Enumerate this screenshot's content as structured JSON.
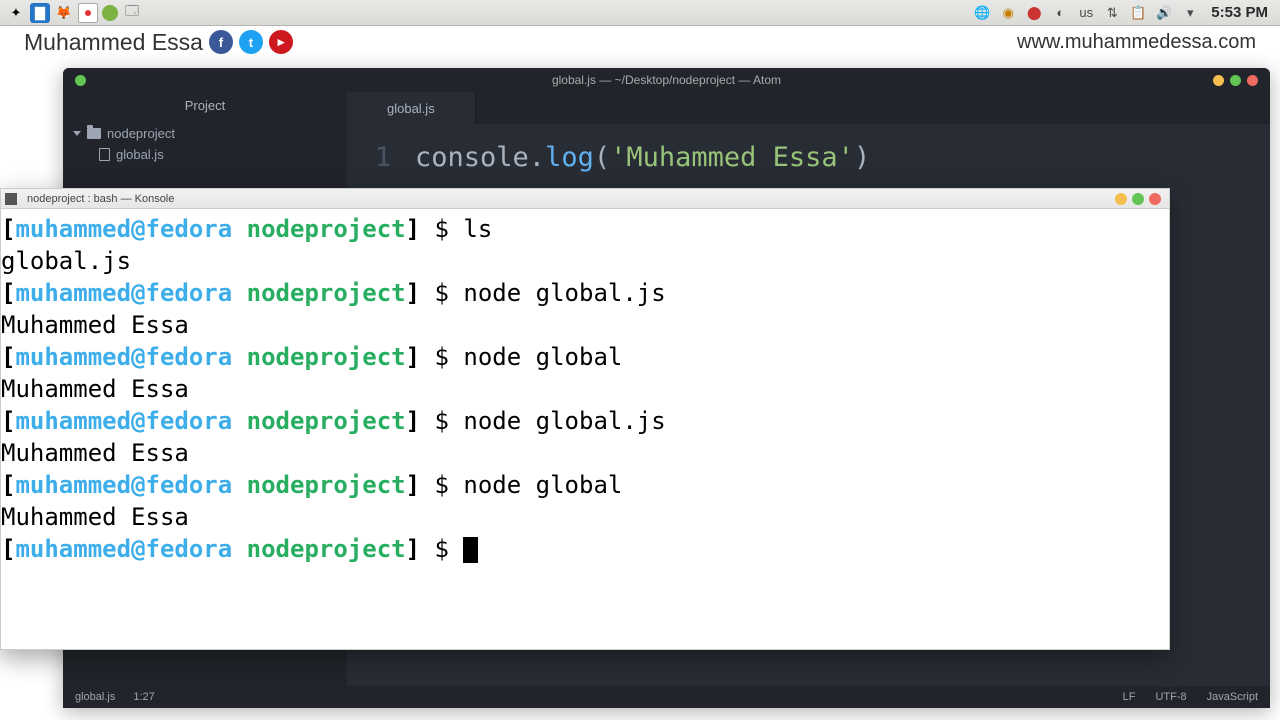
{
  "taskbar": {
    "keyboard_layout": "us",
    "clock": "5:53 PM"
  },
  "branding": {
    "name": "Muhammed Essa",
    "url": "www.muhammedessa.com"
  },
  "atom": {
    "title": "global.js — ~/Desktop/nodeproject — Atom",
    "sidebar_header": "Project",
    "tree": {
      "root": "nodeproject",
      "file": "global.js"
    },
    "tab": "global.js",
    "code": {
      "line_num": "1",
      "token_fn": "console",
      "token_dot": ".",
      "token_method": "log",
      "token_open": "(",
      "token_str": "'Muhammed Essa'",
      "token_close": ")"
    },
    "status": {
      "file": "global.js",
      "pos": "1:27",
      "eol": "LF",
      "enc": "UTF-8",
      "lang": "JavaScript"
    }
  },
  "terminal": {
    "title": "nodeproject : bash — Konsole",
    "prompt_user": "muhammed@fedora",
    "prompt_dir": "nodeproject",
    "lines": [
      {
        "cmd": "ls"
      },
      {
        "out": "global.js"
      },
      {
        "cmd": "node global.js"
      },
      {
        "out": "Muhammed Essa"
      },
      {
        "cmd": "node global"
      },
      {
        "out": "Muhammed Essa"
      },
      {
        "cmd": "node global.js"
      },
      {
        "out": "Muhammed Essa"
      },
      {
        "cmd": "node global"
      },
      {
        "out": "Muhammed Essa"
      },
      {
        "cmd": ""
      }
    ]
  }
}
